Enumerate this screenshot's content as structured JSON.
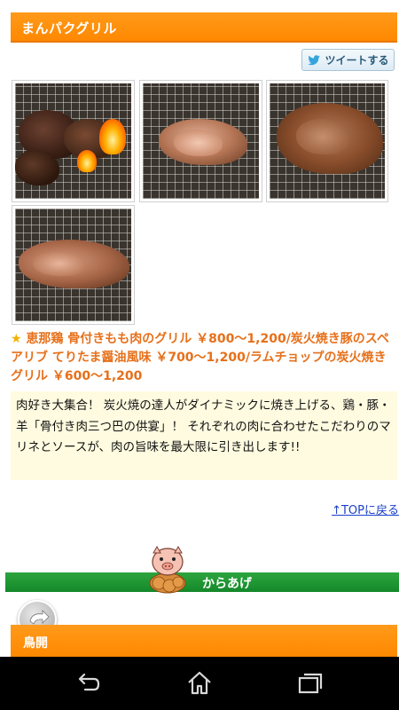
{
  "header": {
    "title": "まんパクグリル"
  },
  "tweet": {
    "label": "ツイートする",
    "icon": "twitter-bird-icon"
  },
  "gallery": {
    "photos": [
      {
        "name": "grill-photo-1"
      },
      {
        "name": "grill-photo-2"
      },
      {
        "name": "grill-photo-3"
      },
      {
        "name": "grill-photo-4"
      }
    ]
  },
  "menu": {
    "star": "★",
    "text": "恵那鶏 骨付きもも肉のグリル ￥800～1,200/炭火焼き豚のスペアリブ てりたま醤油風味 ￥700～1,200/ラムチョップの炭火焼きグリル ￥600～1,200"
  },
  "description": "肉好き大集合！ 炭火焼の達人がダイナミックに焼き上げる、鶏・豚・羊「骨付き肉三つ巴の供宴」！ それぞれの肉に合わせたこだわりのマリネとソースが、肉の旨味を最大限に引き出します!!",
  "links": {
    "top": "↑TOPに戻る"
  },
  "next_section": {
    "title": "からあげ",
    "mascot": "pig-mascot-icon"
  },
  "bottom_section": {
    "title": "鳥開"
  },
  "colors": {
    "accent_orange": "#ff8c00",
    "link_blue": "#1a3fc9",
    "green": "#1a952f",
    "desc_bg": "#fffbe0"
  }
}
